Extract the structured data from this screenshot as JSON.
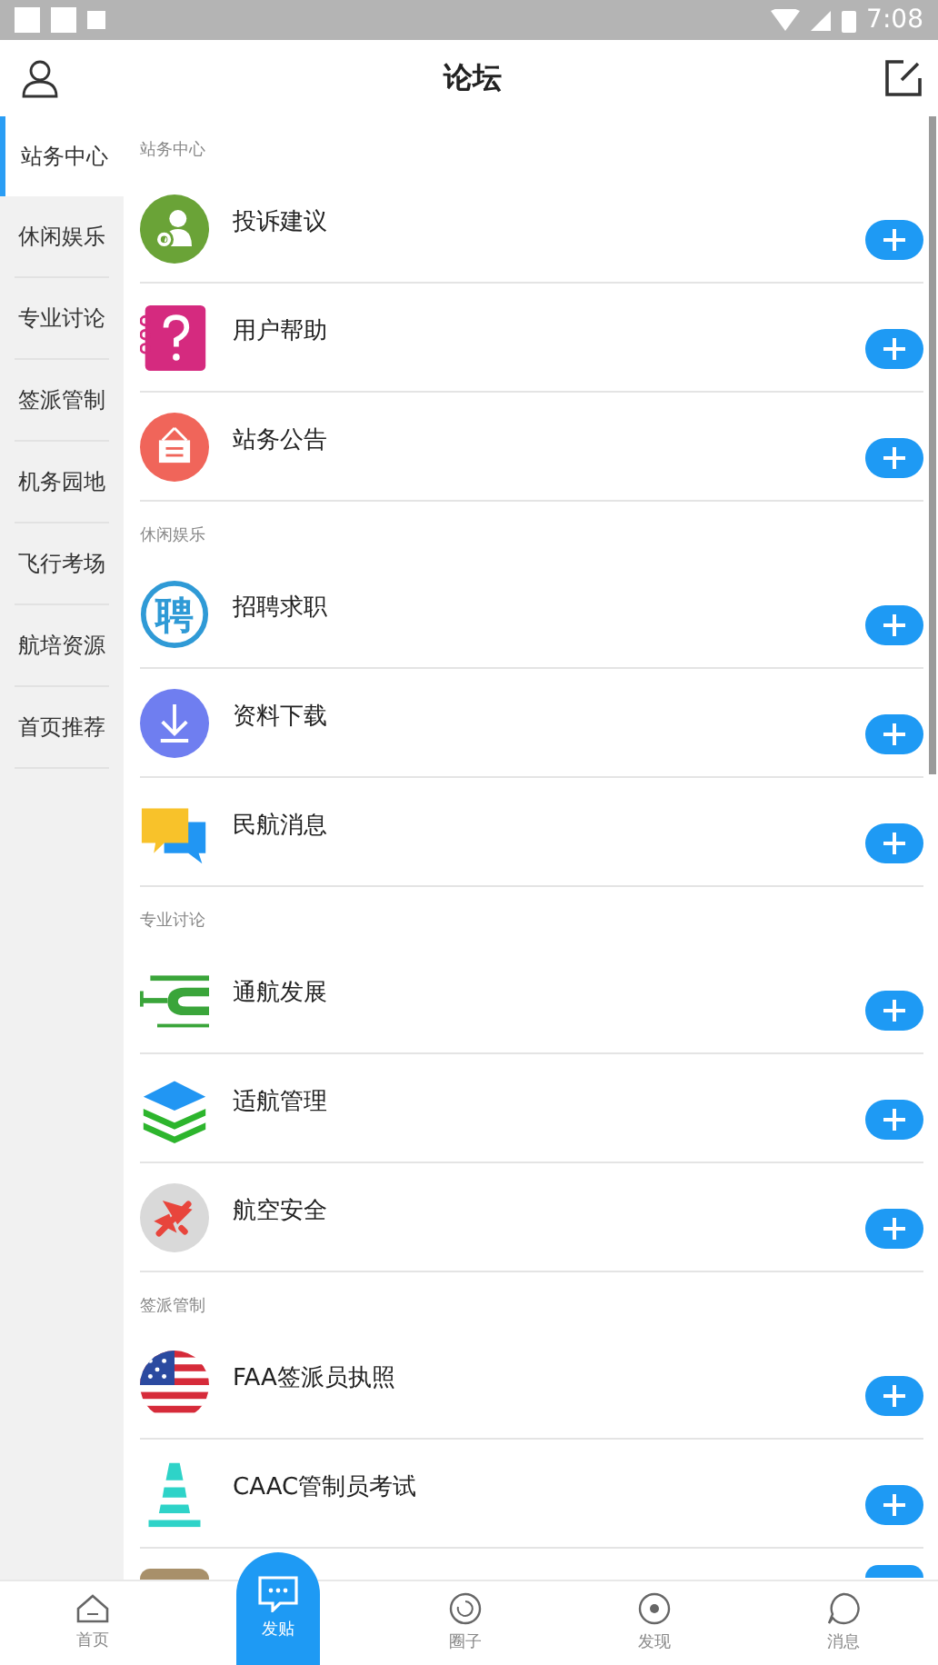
{
  "status_bar": {
    "time": "7:08"
  },
  "header": {
    "title": "论坛"
  },
  "sidebar": {
    "items": [
      {
        "label": "站务中心",
        "selected": true
      },
      {
        "label": "休闲娱乐",
        "selected": false
      },
      {
        "label": "专业讨论",
        "selected": false
      },
      {
        "label": "签派管制",
        "selected": false
      },
      {
        "label": "机务园地",
        "selected": false
      },
      {
        "label": "飞行考场",
        "selected": false
      },
      {
        "label": "航培资源",
        "selected": false
      },
      {
        "label": "首页推荐",
        "selected": false
      }
    ]
  },
  "sections": [
    {
      "title": "站务中心",
      "items": [
        {
          "name": "投诉建议"
        },
        {
          "name": "用户帮助"
        },
        {
          "name": "站务公告"
        }
      ]
    },
    {
      "title": "休闲娱乐",
      "items": [
        {
          "name": "招聘求职",
          "glyph": "聘"
        },
        {
          "name": "资料下载"
        },
        {
          "name": "民航消息"
        }
      ]
    },
    {
      "title": "专业讨论",
      "items": [
        {
          "name": "通航发展"
        },
        {
          "name": "适航管理"
        },
        {
          "name": "航空安全"
        }
      ]
    },
    {
      "title": "签派管制",
      "items": [
        {
          "name": "FAA签派员执照",
          "kind": "named"
        },
        {
          "name": "CAAC管制员考试",
          "kind": "named"
        },
        {
          "kind": "covered"
        }
      ]
    }
  ],
  "tab_bar": [
    {
      "label": "首页",
      "kind": "home",
      "selected": false
    },
    {
      "label": "发贴",
      "kind": "post",
      "selected": true
    },
    {
      "label": "圈子",
      "kind": "circle",
      "selected": false
    },
    {
      "label": "发现",
      "kind": "discover",
      "selected": false
    },
    {
      "label": "消息",
      "kind": "message",
      "selected": false
    }
  ]
}
